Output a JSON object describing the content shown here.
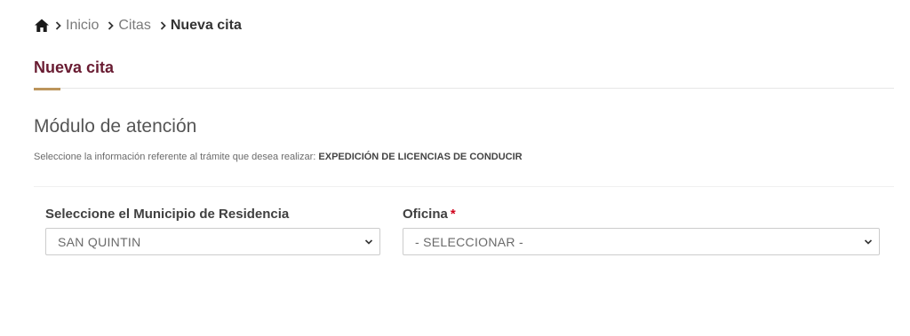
{
  "breadcrumb": {
    "home_icon": "home-icon",
    "items": [
      {
        "label": "Inicio"
      },
      {
        "label": "Citas"
      },
      {
        "label": "Nueva cita"
      }
    ]
  },
  "page": {
    "title": "Nueva cita",
    "title_color": "#691c32",
    "accent_color": "#bc955c"
  },
  "section": {
    "heading": "Módulo de atención",
    "instruction_prefix": "Seleccione la información referente al trámite que desea realizar:",
    "instruction_tramite": "EXPEDICIÓN DE LICENCIAS DE CONDUCIR"
  },
  "form": {
    "municipio": {
      "label": "Seleccione el Municipio de Residencia",
      "selected": "SAN QUINTIN"
    },
    "oficina": {
      "label": "Oficina",
      "required_mark": "*",
      "selected": "- SELECCIONAR -"
    }
  }
}
